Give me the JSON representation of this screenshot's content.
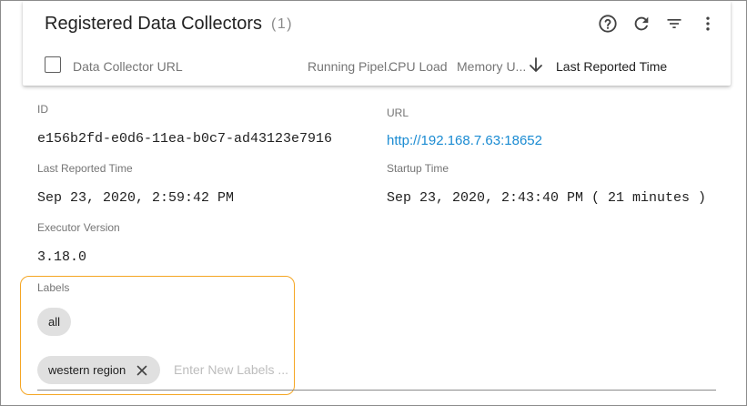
{
  "header": {
    "title": "Registered Data Collectors",
    "count": "(1)",
    "icons": [
      "help-icon",
      "refresh-icon",
      "filter-icon",
      "more-vert-icon"
    ],
    "columns": [
      {
        "label": "Data Collector URL"
      },
      {
        "label": "Running Pipel..."
      },
      {
        "label": "CPU Load"
      },
      {
        "label": "Memory U..."
      },
      {
        "label": "Last Reported Time"
      }
    ],
    "sort_icon": "arrow-down-icon"
  },
  "details": {
    "id_label": "ID",
    "id_value": "e156b2fd-e0d6-11ea-b0c7-ad43123e7916",
    "url_label": "URL",
    "url_value": "http://192.168.7.63:18652",
    "last_reported_label": "Last Reported Time",
    "last_reported_value": "Sep 23, 2020, 2:59:42 PM",
    "startup_label": "Startup Time",
    "startup_value": "Sep 23, 2020, 2:43:40 PM ( 21 minutes )",
    "executor_label": "Executor Version",
    "executor_value": "3.18.0"
  },
  "labels": {
    "title": "Labels",
    "chips": [
      "all",
      "western region"
    ],
    "input_placeholder": "Enter New Labels ...",
    "remove_icon": "close-icon"
  },
  "colors": {
    "accent_link": "#1a8bd2",
    "highlight_border": "#f5a623",
    "chip_bg": "#e0e0e0"
  }
}
